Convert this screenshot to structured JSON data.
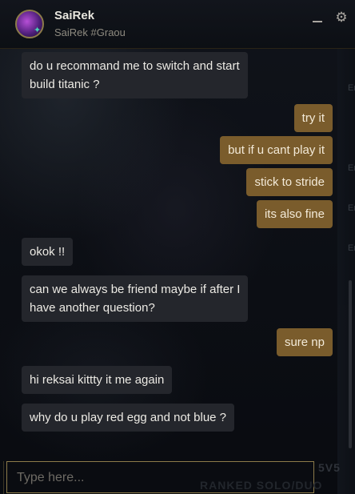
{
  "header": {
    "name": "SaiRek",
    "tag": "SaiRek #Graou",
    "minimize_icon": "minimize-icon",
    "settings_icon": "gear-icon"
  },
  "messages": [
    {
      "side": "in",
      "lines": [
        "do u recommand me to switch and start",
        "build titanic ?"
      ]
    },
    {
      "side": "out",
      "lines": [
        "try it"
      ]
    },
    {
      "side": "out",
      "lines": [
        "but if u cant play it"
      ]
    },
    {
      "side": "out",
      "lines": [
        "stick to stride"
      ]
    },
    {
      "side": "out",
      "lines": [
        "its also fine"
      ]
    },
    {
      "side": "in",
      "lines": [
        "okok !!"
      ]
    },
    {
      "side": "in",
      "lines": [
        "can we always be friend maybe if after I",
        "have another question?"
      ]
    },
    {
      "side": "out",
      "lines": [
        "sure np"
      ]
    },
    {
      "side": "in",
      "lines": [
        "hi reksai kittty it me again"
      ]
    },
    {
      "side": "in",
      "lines": [
        "why do u play red egg and not blue ?"
      ]
    }
  ],
  "input": {
    "placeholder": "Type here..."
  },
  "background": {
    "strip_labels": [
      "Er",
      "Er",
      "Er",
      "Er"
    ],
    "mode": "5V5",
    "queue": "RANKED SOLO/DUO"
  },
  "colors": {
    "incoming_bubble": "#24262c",
    "outgoing_bubble": "#7a5c2c",
    "accent_gold": "#8c7b4a"
  }
}
